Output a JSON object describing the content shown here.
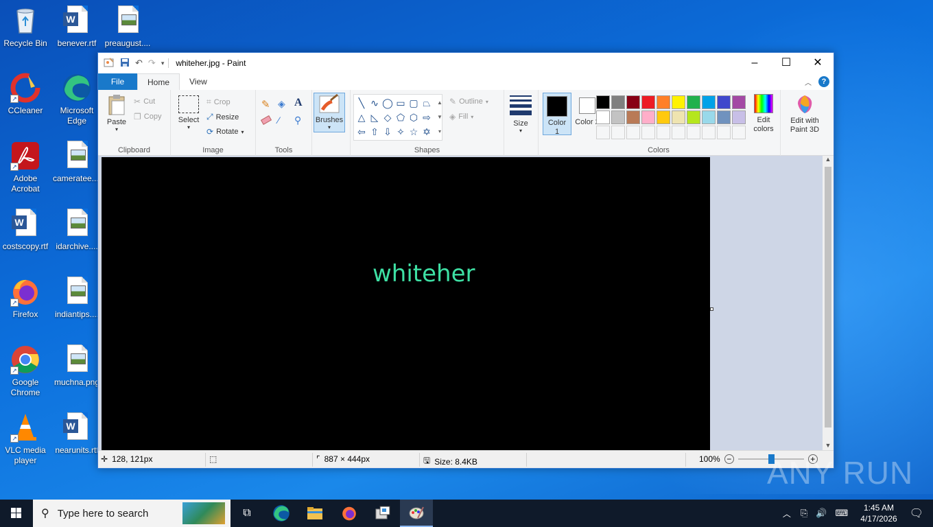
{
  "desktop": {
    "icons": [
      {
        "label": "Recycle Bin"
      },
      {
        "label": "benever.rtf"
      },
      {
        "label": "preaugust...."
      },
      {
        "label": "CCleaner"
      },
      {
        "label": "Microsoft Edge"
      },
      {
        "label": "Adobe Acrobat"
      },
      {
        "label": "cameratee...."
      },
      {
        "label": "costscopy.rtf"
      },
      {
        "label": "idarchive...."
      },
      {
        "label": "Firefox"
      },
      {
        "label": "indiantips...."
      },
      {
        "label": "Google Chrome"
      },
      {
        "label": "muchna.png"
      },
      {
        "label": "VLC media player"
      },
      {
        "label": "nearunits.rtf"
      }
    ]
  },
  "window": {
    "title": "whiteher.jpg - Paint",
    "tabs": {
      "file": "File",
      "home": "Home",
      "view": "View"
    }
  },
  "ribbon": {
    "clipboard": {
      "label": "Clipboard",
      "paste": "Paste",
      "cut": "Cut",
      "copy": "Copy"
    },
    "image": {
      "label": "Image",
      "select": "Select",
      "crop": "Crop",
      "resize": "Resize",
      "rotate": "Rotate"
    },
    "tools": {
      "label": "Tools"
    },
    "brushes": {
      "label": "Brushes"
    },
    "shapes": {
      "label": "Shapes",
      "outline": "Outline",
      "fill": "Fill"
    },
    "size": {
      "label": "Size"
    },
    "colors": {
      "label": "Colors",
      "color1": "Color 1",
      "color2": "Color 2",
      "edit_colors": "Edit colors",
      "edit_3d": "Edit with Paint 3D",
      "palette_row1": [
        "#000000",
        "#7f7f7f",
        "#880015",
        "#ed1c24",
        "#ff7f27",
        "#fff200",
        "#22b14c",
        "#00a2e8",
        "#3f48cc",
        "#a349a4"
      ],
      "palette_row2": [
        "#ffffff",
        "#c3c3c3",
        "#b97a57",
        "#ffaec9",
        "#ffc90e",
        "#efe4b0",
        "#b5e61d",
        "#99d9ea",
        "#7092be",
        "#c8bfe7"
      ]
    }
  },
  "canvas": {
    "text": "whiteher",
    "text_color": "#3ee0a4"
  },
  "status": {
    "cursor": "128, 121px",
    "dimensions": "887 × 444px",
    "size": "Size: 8.4KB",
    "zoom": "100%"
  },
  "taskbar": {
    "search_placeholder": "Type here to search",
    "time": "1:45 AM",
    "date": "4/17/2026"
  },
  "watermark": "ANY RUN"
}
